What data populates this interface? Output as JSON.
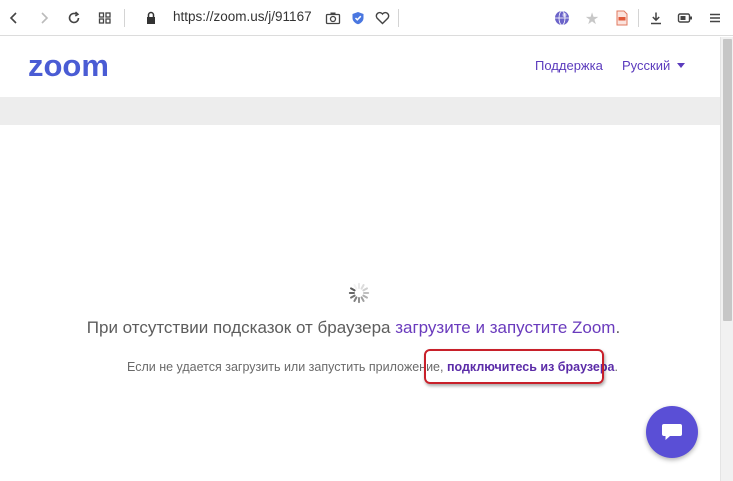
{
  "browser": {
    "url": "https://zoom.us/j/91167",
    "icons": [
      "back-icon",
      "forward-icon",
      "reload-icon",
      "grid-icon",
      "lock-icon",
      "camera-icon",
      "shield-icon",
      "heart-icon",
      "globe-icon",
      "star-icon",
      "pdf-icon",
      "download-icon",
      "battery-icon",
      "menu-icon"
    ]
  },
  "header": {
    "logo": "zoom",
    "support_link": "Поддержка",
    "language_link": "Русский"
  },
  "main": {
    "headline_text": "При отсутствии подсказок от браузера ",
    "headline_link": "загрузите и запустите Zoom",
    "headline_end": ".",
    "sub_text": "Если не удается загрузить или запустить приложение, ",
    "sub_link": "подключитесь из браузера",
    "sub_end": "."
  },
  "colors": {
    "brand": "#4a5cd4",
    "link": "#6a3bbd",
    "highlight": "#c8202a",
    "chat_button": "#5a4fd6"
  }
}
